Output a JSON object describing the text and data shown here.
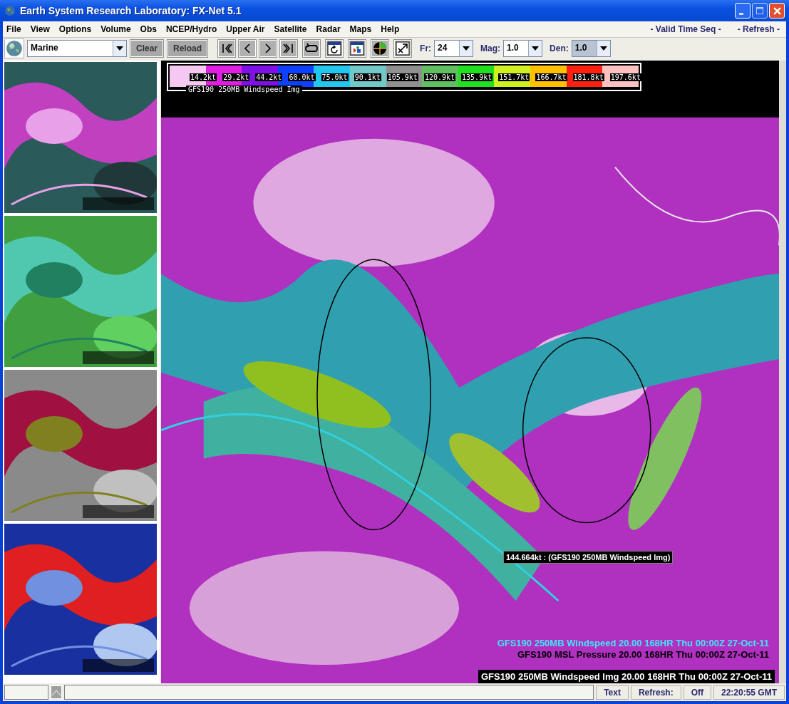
{
  "window": {
    "title": "Earth System Research Laboratory: FX-Net 5.1"
  },
  "menu": [
    "File",
    "View",
    "Options",
    "Volume",
    "Obs",
    "NCEP/Hydro",
    "Upper Air",
    "Satellite",
    "Radar",
    "Maps",
    "Help"
  ],
  "menu_right": [
    "- Valid Time Seq -",
    "- Refresh -"
  ],
  "toolbar": {
    "product": "Marine",
    "buttons": [
      "Clear",
      "Reload"
    ],
    "fields": [
      {
        "label": "Fr:",
        "value": "24",
        "disabled": false
      },
      {
        "label": "Mag:",
        "value": "1.0",
        "disabled": false
      },
      {
        "label": "Den:",
        "value": "1.0",
        "disabled": true
      }
    ]
  },
  "thumbnails": [
    {
      "kind": "picture"
    },
    {
      "kind": "picture"
    },
    {
      "kind": "picture"
    },
    {
      "kind": "picture"
    }
  ],
  "legend": {
    "title": "GFS190 250MB Windspeed Img",
    "stops": [
      {
        "label": "14.2kt",
        "color": "#f4c8f0"
      },
      {
        "label": "29.2kt",
        "color": "#e020e0"
      },
      {
        "label": "44.2kt",
        "color": "#8010e8"
      },
      {
        "label": "60.0kt",
        "color": "#1040ff"
      },
      {
        "label": "75.0kt",
        "color": "#20c8f0"
      },
      {
        "label": "90.1kt",
        "color": "#70c8c8"
      },
      {
        "label": "105.9kt",
        "color": "#909090"
      },
      {
        "label": "120.9kt",
        "color": "#60c060"
      },
      {
        "label": "135.9kt",
        "color": "#20e020"
      },
      {
        "label": "151.7kt",
        "color": "#d0f020"
      },
      {
        "label": "166.7kt",
        "color": "#ffc000"
      },
      {
        "label": "181.8kt",
        "color": "#ff2010"
      },
      {
        "label": "197.6kt",
        "color": "#ffc0c0"
      }
    ]
  },
  "tooltip": "144.664kt : (GFS190 250MB Windspeed Img)",
  "overlay_labels": [
    {
      "text": "GFS190 250MB Windspeed  20.00 168HR Thu 00:00Z 27-Oct-11",
      "color": "#40e8f8"
    },
    {
      "text": "GFS190 MSL Pressure  20.00 168HR Thu 00:00Z 27-Oct-11",
      "color": "#000000"
    }
  ],
  "image_label": "GFS190 250MB Windspeed Img 20.00 168HR Thu 00:00Z 27-Oct-11",
  "status_bar": {
    "mode": "Text",
    "refresh_label": "Refresh:",
    "refresh_value": "Off",
    "time": "22:20:55 GMT"
  }
}
